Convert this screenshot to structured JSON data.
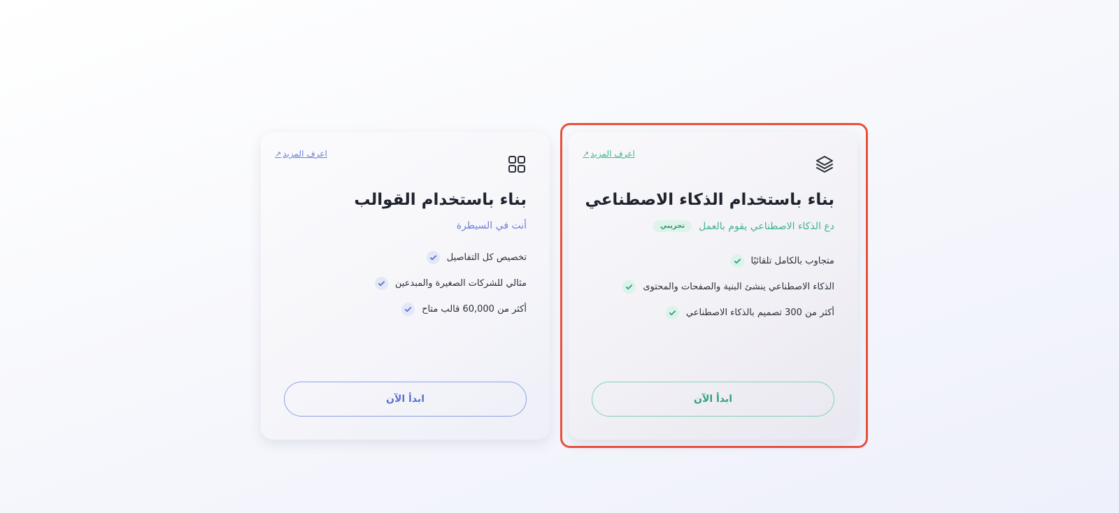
{
  "cards": {
    "templates": {
      "learn_more": "اعرف المزيد",
      "learn_more_icon": "external-link-arrow-icon",
      "icon": "grid-icon",
      "title": "بناء باستخدام القوالب",
      "subtitle": "أنت في السيطرة",
      "features": [
        "تخصيص كل التفاصيل",
        "مثالي للشركات الصغيرة والمبدعين",
        "أكثر من 60,000 قالب متاح"
      ],
      "button_label": "ابدأ الآن",
      "accent_color": "#6b7fd6"
    },
    "ai": {
      "learn_more": "اعرف المزيد",
      "learn_more_icon": "external-link-arrow-icon",
      "icon": "layers-icon",
      "title": "بناء باستخدام الذكاء الاصطناعي",
      "subtitle": "دع الذكاء الاصطناعي يقوم بالعمل",
      "badge": "تجريبي",
      "features": [
        "متجاوب بالكامل تلقائيًا",
        "الذكاء الاصطناعي ينشئ البنية والصفحات والمحتوى",
        "أكثر من 300 تصميم بالذكاء الاصطناعي"
      ],
      "button_label": "ابدأ الآن",
      "accent_color": "#3fb58f",
      "selected": true,
      "highlight_color": "#e8503a"
    }
  }
}
